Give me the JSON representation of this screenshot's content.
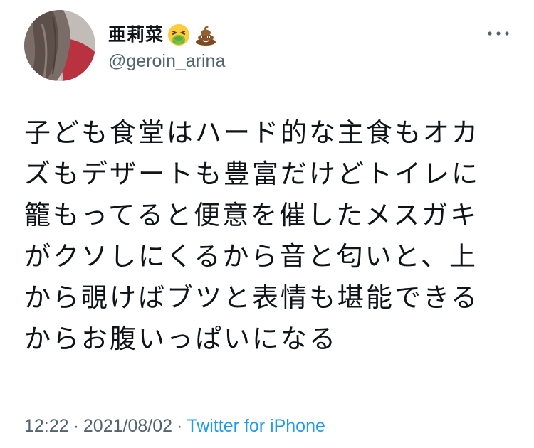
{
  "tweet": {
    "display_name": "亜莉菜",
    "name_emojis": [
      "nauseated-face-emoji",
      "pile-of-poo-emoji"
    ],
    "handle": "@geroin_arina",
    "more_icon": "more-horizontal-icon",
    "text": "子ども食堂はハード的な主食もオカ\nズもデザートも豊富だけどトイレに\n籠もってると便意を催したメスガキ\nがクソしにくるから音と匂いと、上\nから覗けばブツと表情も堪能できる\nからお腹いっぱいになる",
    "time": "12:22",
    "date": "2021/08/02",
    "separator": "·",
    "source": "Twitter for iPhone"
  },
  "colors": {
    "text": "#0f1419",
    "secondary": "#536471",
    "link": "#1d9bf0"
  }
}
